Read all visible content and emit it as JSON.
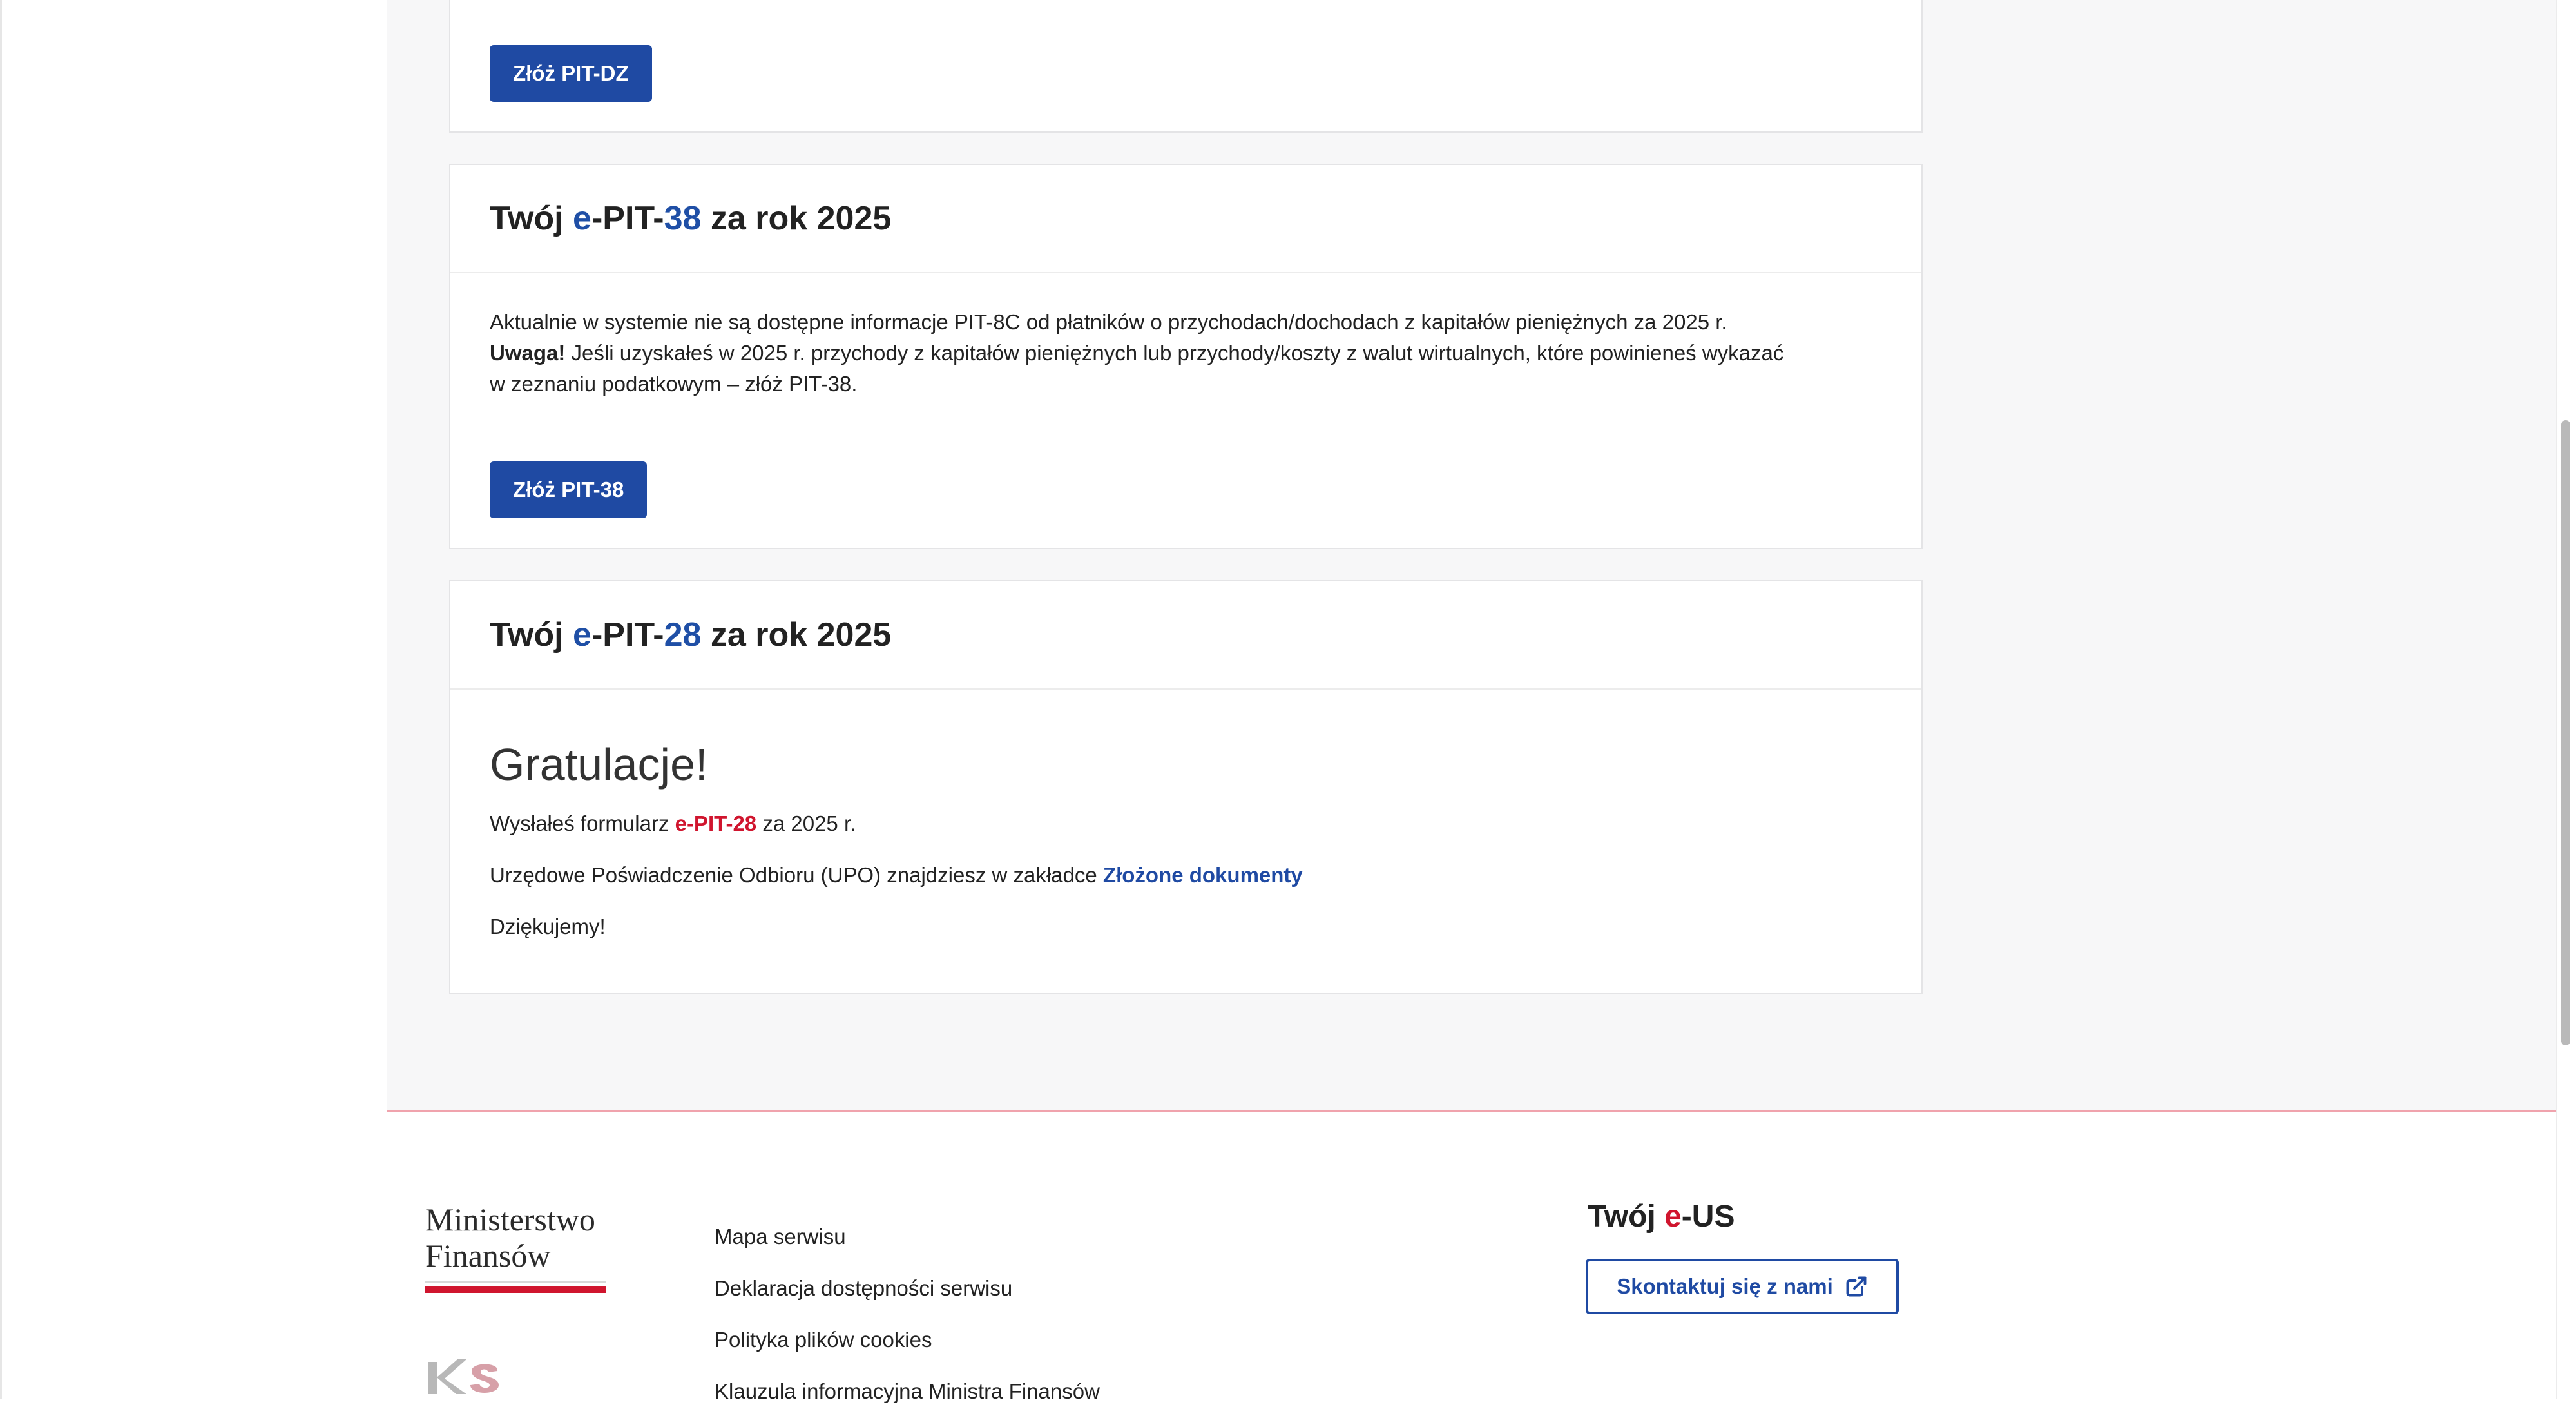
{
  "cards": {
    "pit_dz": {
      "button_label": "Złóż PIT-DZ"
    },
    "pit_38": {
      "title_prefix": "Twój ",
      "title_e": "e",
      "title_pit": "-PIT-",
      "title_num": "38",
      "title_suffix": " za rok 2025",
      "line1": "Aktualnie w systemie nie są dostępne informacje PIT-8C od płatników o przychodach/dochodach z kapitałów pieniężnych za 2025 r.",
      "warning_label": "Uwaga!",
      "line2": " Jeśli uzyskałeś w 2025 r. przychody z kapitałów pieniężnych lub przychody/koszty z walut wirtualnych, które powinieneś wykazać",
      "line3": "w zeznaniu podatkowym – złóż PIT-38.",
      "button_label": "Złóż PIT-38"
    },
    "pit_28": {
      "title_prefix": "Twój ",
      "title_e": "e",
      "title_pit": "-PIT-",
      "title_num": "28",
      "title_suffix": " za rok 2025",
      "congrats": "Gratulacje!",
      "sent_prefix": "Wysłałeś formularz ",
      "sent_e": "e-PIT-",
      "sent_num": "28",
      "sent_suffix": " za 2025 r.",
      "upo_text": "Urzędowe Poświadczenie Odbioru (UPO) znajdziesz w zakładce ",
      "upo_link": "Złożone dokumenty",
      "thanks": "Dziękujemy!"
    }
  },
  "footer": {
    "logo_line1": "Ministerstwo",
    "logo_line2": "Finansów",
    "links": [
      "Mapa serwisu",
      "Deklaracja dostępności serwisu",
      "Polityka plików cookies",
      "Klauzula informacyjna Ministra Finansów"
    ],
    "eus_prefix": "Twój ",
    "eus_e": "e",
    "eus_suffix": "-US",
    "contact_label": "Skontaktuj się z nami"
  },
  "colors": {
    "primary_blue": "#1f4aa3",
    "accent_red": "#d0152e",
    "page_bg": "#f7f7f8"
  }
}
